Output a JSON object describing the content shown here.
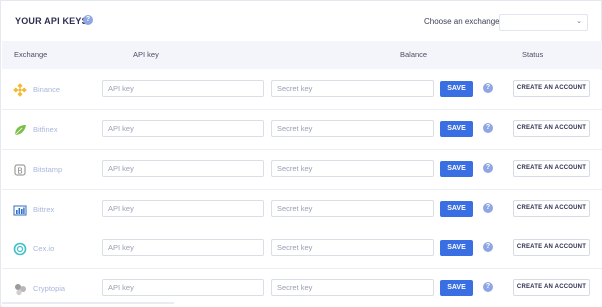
{
  "header": {
    "title": "YOUR API KEYS",
    "exchange_label": "Choose an exchange",
    "exchange_selected": ""
  },
  "table": {
    "columns": [
      "Exchange",
      "API key",
      "Balance",
      "Status"
    ],
    "rows": [
      {
        "exchange": "Binance",
        "logo": "binance-logo",
        "color": "#f3ba2f"
      },
      {
        "exchange": "Bitfinex",
        "logo": "bitfinex-logo",
        "color": "#7bbf4a"
      },
      {
        "exchange": "Bitstamp",
        "logo": "bitstamp-logo",
        "color": "#8a8a8a"
      },
      {
        "exchange": "Bittrex",
        "logo": "bittrex-logo",
        "color": "#2f6dc6"
      },
      {
        "exchange": "Cex.io",
        "logo": "cexio-logo",
        "color": "#3fbfc9"
      },
      {
        "exchange": "Cryptopia",
        "logo": "cryptopia-logo",
        "color": "#9a9a9a"
      }
    ],
    "api_key_placeholder": "API key",
    "secret_key_placeholder": "Secret key",
    "save_label": "SAVE",
    "create_label": "CREATE AN ACCOUNT"
  },
  "colors": {
    "accent": "#3a6fe3",
    "help": "#8ea6e3",
    "header_bg": "#f4f5fa"
  }
}
